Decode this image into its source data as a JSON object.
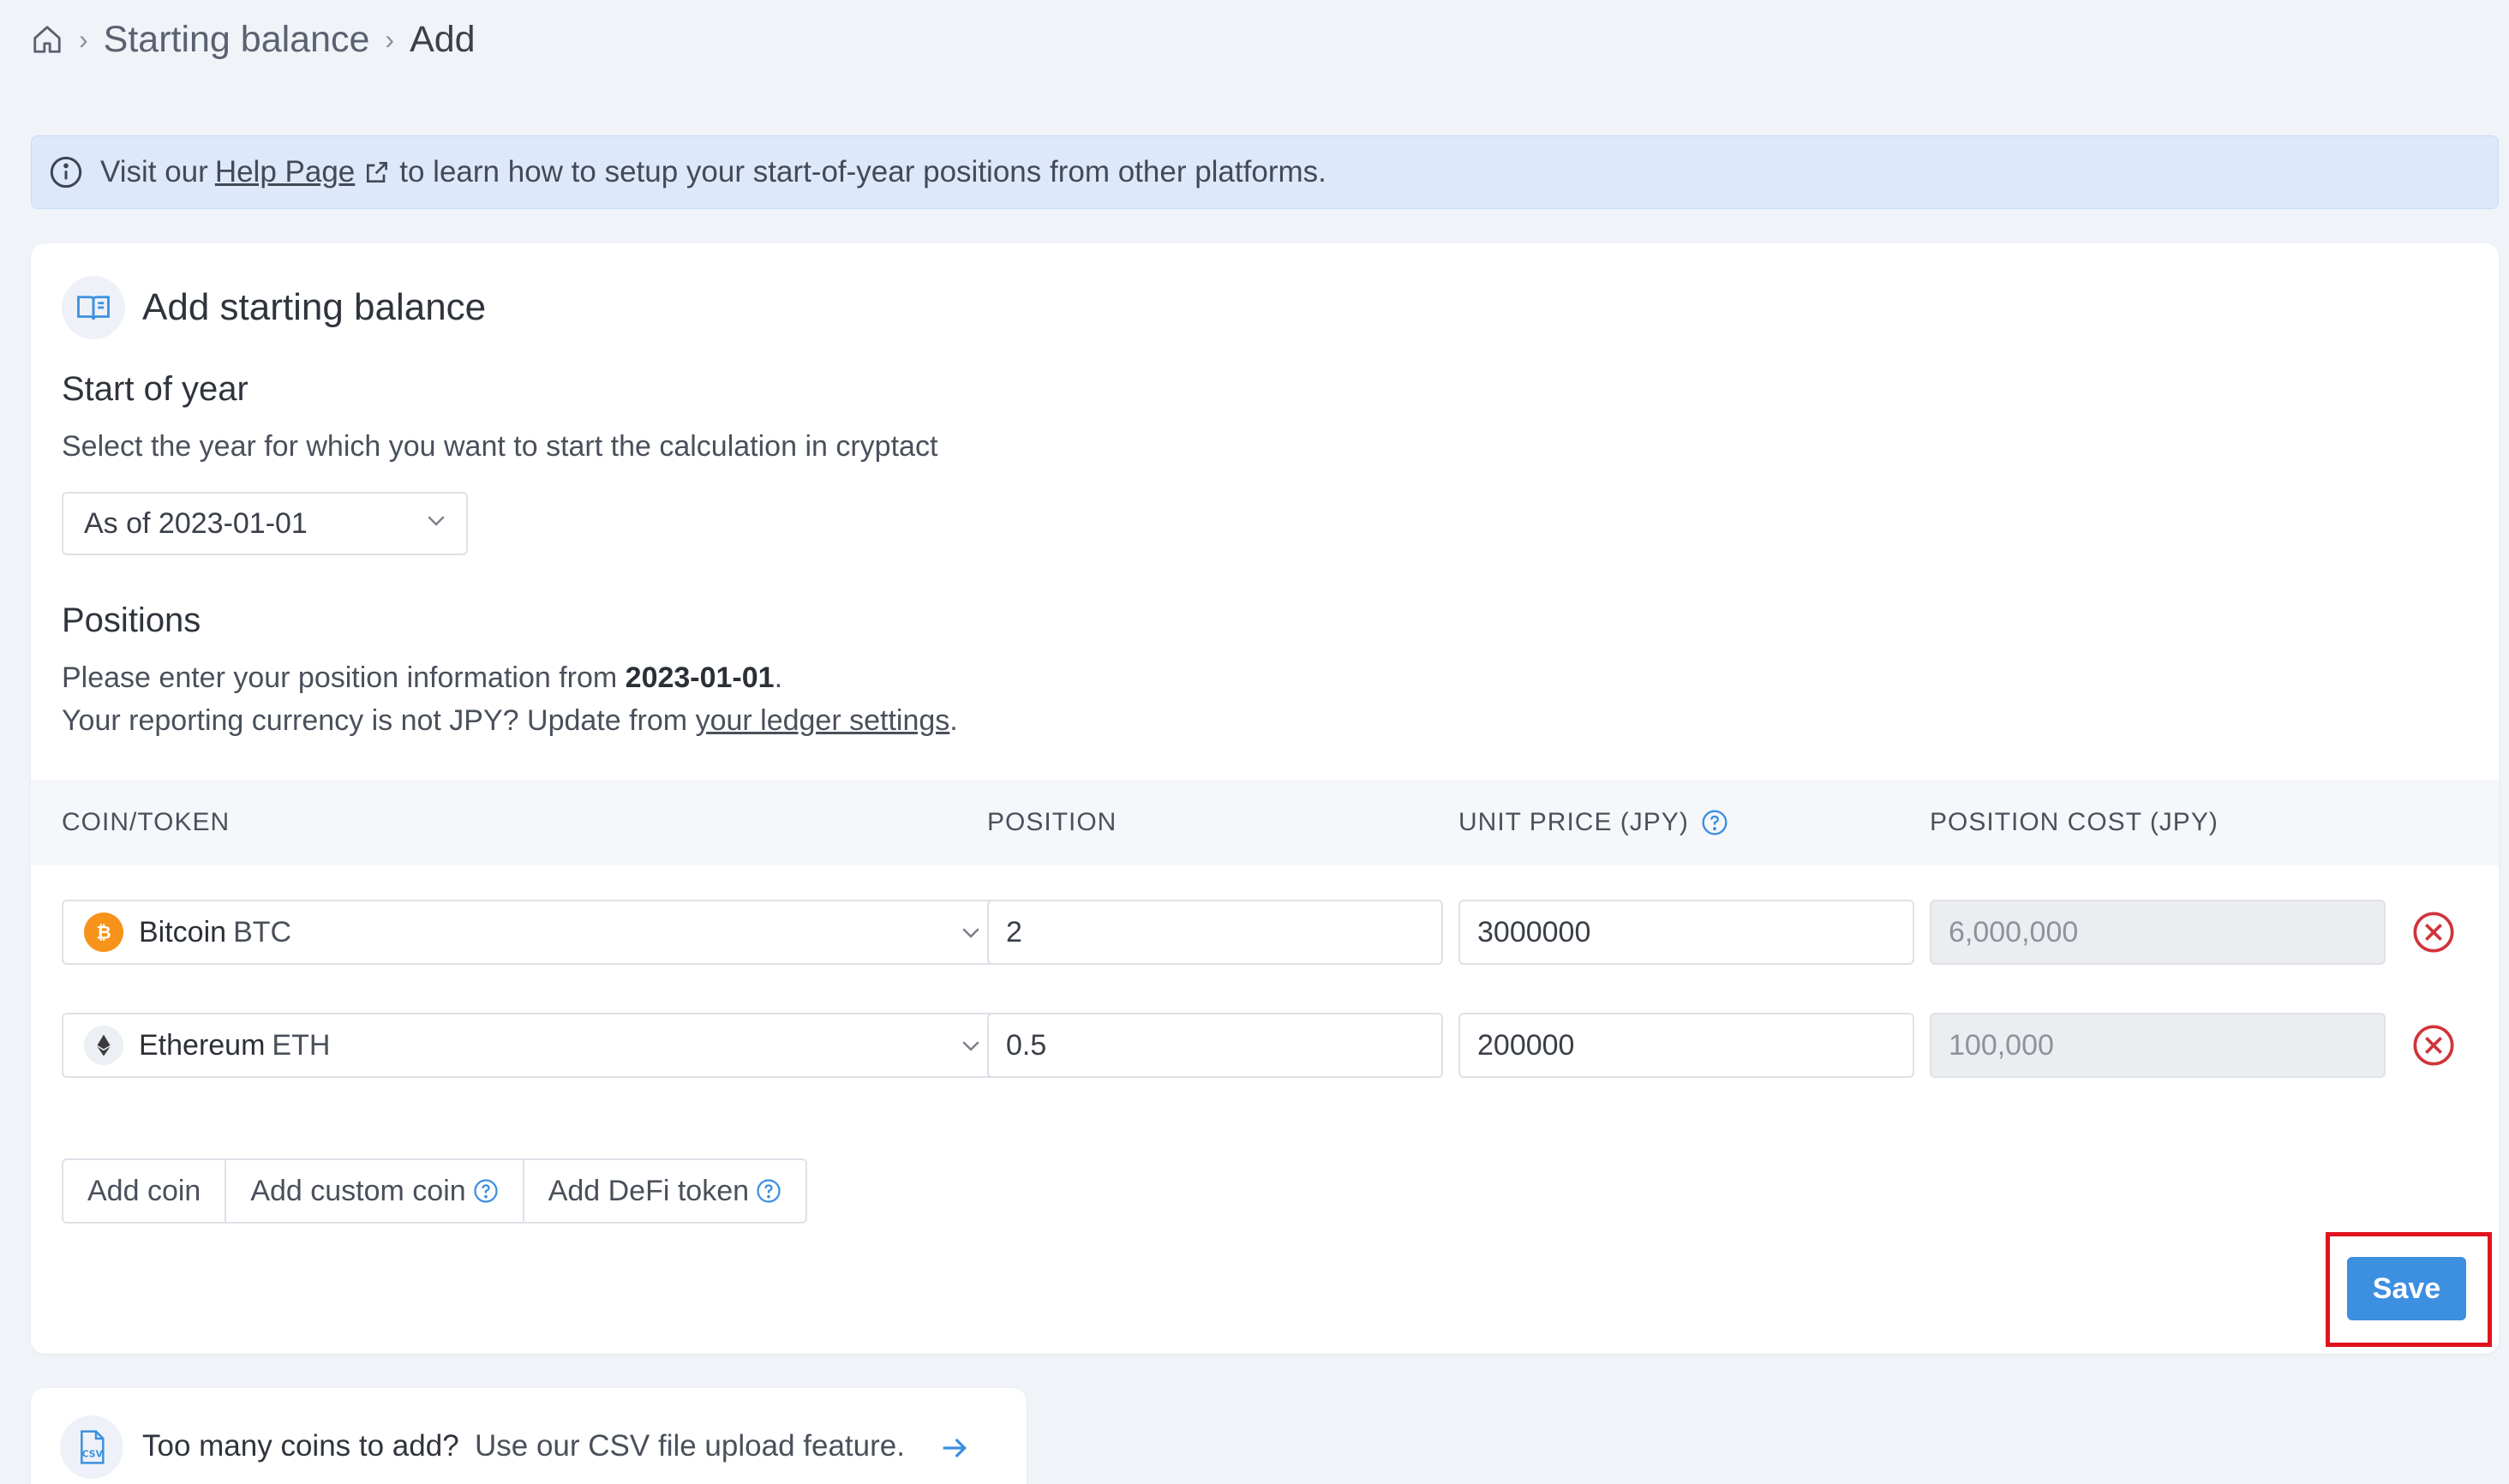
{
  "breadcrumb": {
    "home_icon": "home-icon",
    "sep1": "›",
    "item1": "Starting balance",
    "sep2": "›",
    "current": "Add"
  },
  "banner": {
    "prefix": "Visit our",
    "link": "Help Page",
    "suffix": "to learn how to setup your start-of-year positions from other platforms."
  },
  "card": {
    "title": "Add starting balance",
    "start_of_year": {
      "title": "Start of year",
      "description": "Select the year for which you want to start the calculation in cryptact",
      "selected": "As of 2023-01-01"
    },
    "positions": {
      "title": "Positions",
      "line1_prefix": "Please enter your position information from ",
      "line1_date": "2023-01-01",
      "line1_suffix": ".",
      "line2_prefix": "Your reporting currency is not JPY? Update from ",
      "line2_link": "your ledger settings",
      "line2_suffix": "."
    },
    "table": {
      "headers": {
        "coin": "COIN/TOKEN",
        "position": "POSITION",
        "unit_price": "UNIT PRICE (JPY)",
        "position_cost": "POSITION COST (JPY)"
      },
      "rows": [
        {
          "name": "Bitcoin",
          "symbol": "BTC",
          "icon": "bitcoin-icon",
          "position": "2",
          "unit_price": "3000000",
          "cost": "6,000,000"
        },
        {
          "name": "Ethereum",
          "symbol": "ETH",
          "icon": "ethereum-icon",
          "position": "0.5",
          "unit_price": "200000",
          "cost": "100,000"
        }
      ]
    },
    "buttons": {
      "add_coin": "Add coin",
      "add_custom_coin": "Add custom coin",
      "add_defi_token": "Add DeFi token",
      "save": "Save"
    }
  },
  "csv": {
    "question": "Too many coins to add?",
    "message": "Use our CSV file upload feature."
  },
  "colors": {
    "accent": "#3d8fe0",
    "highlight": "#e0141e",
    "remove": "#d0343a",
    "bitcoin": "#f7931a",
    "banner_bg": "#dde8fb"
  }
}
